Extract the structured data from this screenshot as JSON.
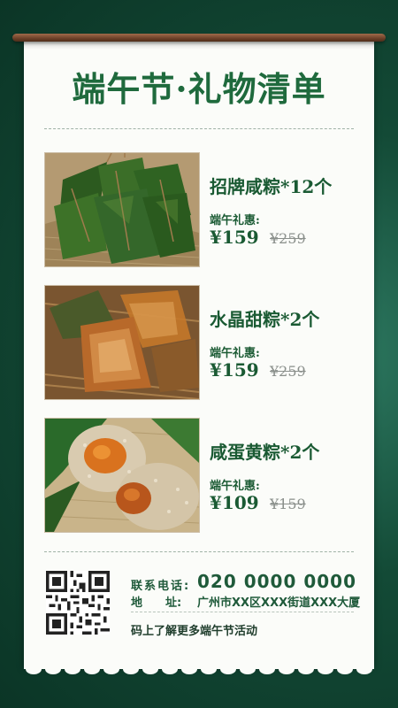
{
  "title": "端午节·礼物清单",
  "products": [
    {
      "name": "招牌咸粽*12个",
      "promo_label": "端午礼惠:",
      "price": "¥159",
      "original_price": "¥259"
    },
    {
      "name": "水晶甜粽*2个",
      "promo_label": "端午礼惠:",
      "price": "¥159",
      "original_price": "¥259"
    },
    {
      "name": "咸蛋黄粽*2个",
      "promo_label": "端午礼惠:",
      "price": "¥109",
      "original_price": "¥159"
    }
  ],
  "contact": {
    "phone_label": "联系电话:",
    "phone": "020 0000 0000",
    "address_label": "地　　址:",
    "address": "广州市XX区XXX街道XXX大厦",
    "tagline": "码上了解更多端午节活动"
  },
  "colors": {
    "brand_green": "#1f6a3d",
    "background": "#134a36",
    "paper": "#fbfcf9"
  }
}
